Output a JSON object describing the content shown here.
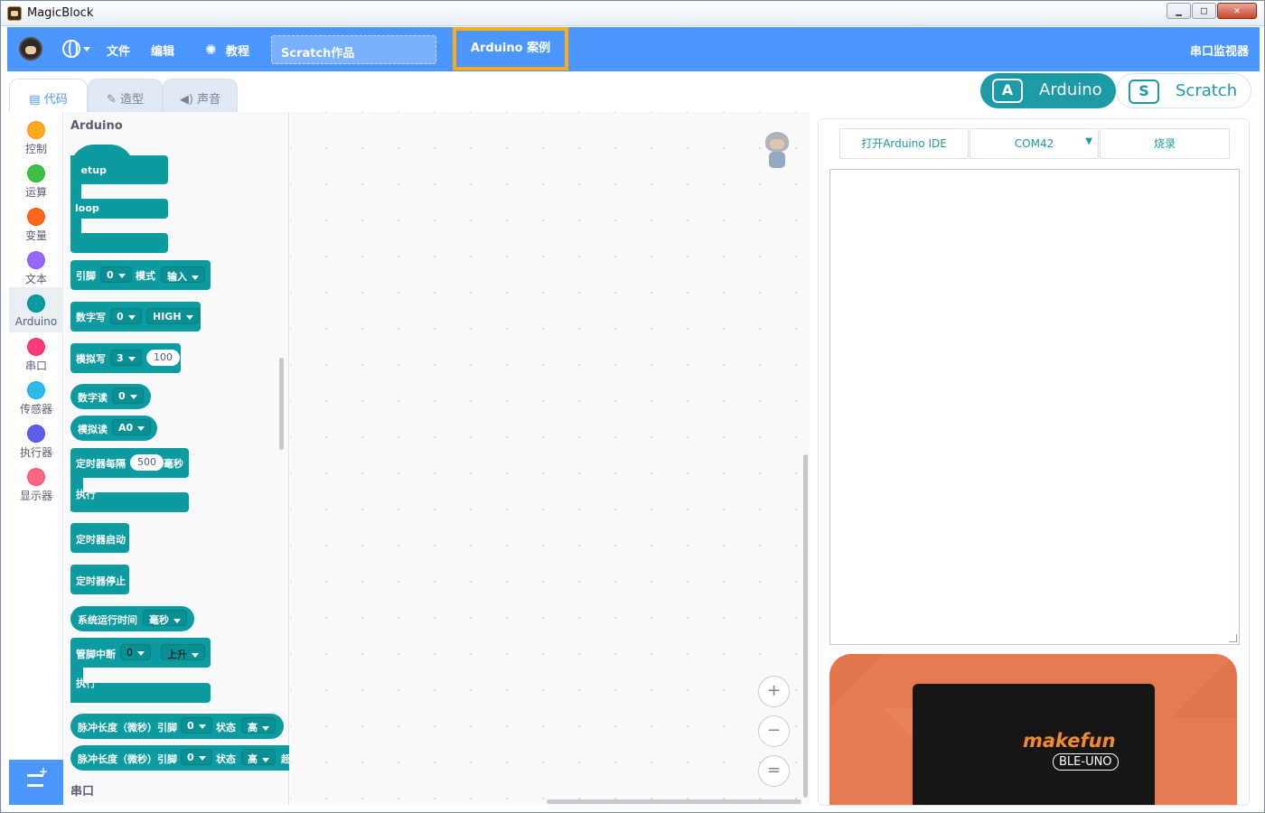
{
  "window": {
    "title": "MagicBlock",
    "buttons": [
      "▁",
      "□",
      "✕"
    ]
  },
  "menubar": {
    "file": "文件",
    "edit": "编辑",
    "tutorial": "教程",
    "project_title": "Scratch作品",
    "arduino_case": "Arduino 案例",
    "serial_monitor": "串口监视器"
  },
  "tabs": [
    {
      "label": "代码",
      "icon": "code-icon"
    },
    {
      "label": "造型",
      "icon": "brush-icon"
    },
    {
      "label": "声音",
      "icon": "speaker-icon"
    }
  ],
  "modes": {
    "arduino": "Arduino",
    "scratch": "Scratch",
    "arduino_letter": "A",
    "scratch_letter": "S"
  },
  "categories": [
    {
      "label": "控制",
      "color": "#ffab19"
    },
    {
      "label": "运算",
      "color": "#40bf4a"
    },
    {
      "label": "变量",
      "color": "#ff6619"
    },
    {
      "label": "文本",
      "color": "#9966ff"
    },
    {
      "label": "Arduino",
      "color": "#0b9ba0"
    },
    {
      "label": "串口",
      "color": "#ff3a7a"
    },
    {
      "label": "传感器",
      "color": "#2bbbe8"
    },
    {
      "label": "执行器",
      "color": "#5b5de8"
    },
    {
      "label": "显示器",
      "color": "#ff6680"
    }
  ],
  "palette": {
    "section_title": "Arduino",
    "footer_section": "串口",
    "blocks": {
      "setup": "setup",
      "loop": "loop",
      "pin_mode": {
        "pin": "引脚",
        "pin_val": "0",
        "mode": "模式",
        "mode_val": "输入"
      },
      "digital_write": {
        "label": "数字写",
        "pin_val": "0",
        "level": "HIGH"
      },
      "analog_write": {
        "label": "模拟写",
        "pin_val": "3",
        "value": "100"
      },
      "digital_read": {
        "label": "数字读",
        "pin_val": "0"
      },
      "analog_read": {
        "label": "模拟读",
        "pin_val": "A0"
      },
      "timer_every": {
        "label": "定时器每隔",
        "value": "500",
        "unit": "毫秒",
        "exec": "执行"
      },
      "timer_start": "定时器启动",
      "timer_stop": "定时器停止",
      "sys_runtime": {
        "label": "系统运行时间",
        "unit": "毫秒"
      },
      "pin_interrupt": {
        "label": "管脚中断",
        "pin_val": "0",
        "edge": "上升",
        "exec": "执行"
      },
      "pulse1": {
        "label": "脉冲长度（微秒）引脚",
        "pin_val": "0",
        "state": "状态",
        "state_val": "高"
      },
      "pulse2": {
        "label": "脉冲长度（微秒）引脚",
        "pin_val": "0",
        "state": "状态",
        "state_val": "高",
        "cut": "超"
      }
    }
  },
  "zoom": {
    "in": "+",
    "out": "−",
    "reset": "="
  },
  "right_panel": {
    "open_ide": "打开Arduino IDE",
    "port": "COM42",
    "upload": "烧录",
    "code_text": ""
  },
  "board": {
    "brand": "makefun",
    "model": "BLE-UNO"
  },
  "colors": {
    "menubar": "#4c97ff",
    "arduino": "#0b9ba0",
    "accent": "#ffab19",
    "board_bg": "#e67b52"
  }
}
